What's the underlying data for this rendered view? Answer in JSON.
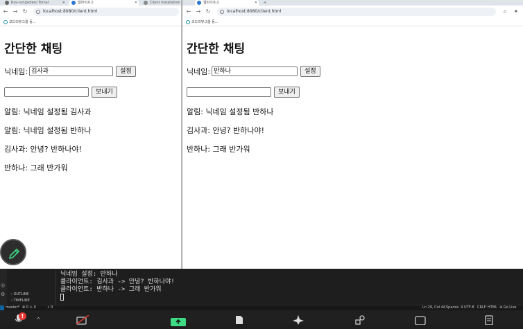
{
  "left_window": {
    "tabs": [
      {
        "label": "Rss-congsolen/ Tornal",
        "active": false
      },
      {
        "label": "웹파이프고",
        "active": true
      },
      {
        "label": "Client installation",
        "active": false
      }
    ],
    "url": "localhost:8080/client.html",
    "bookmark": "코드리뷰그룹 동...",
    "heading": "간단한 채팅",
    "nickname_label": "닉네임:",
    "nickname_value": "김사과",
    "set_button": "설정",
    "message_value": "",
    "send_button": "보내기",
    "messages": [
      "알림: 닉네임 설정됨 김사과",
      "알림: 닉네임 설정됨 반하나",
      "김사과: 안녕? 반하나야!",
      "반하나: 그래 반가워"
    ]
  },
  "right_window": {
    "tabs": [
      {
        "label": "웹파이프고",
        "active": true
      }
    ],
    "url": "localhost:8080/client.html",
    "bookmark": "코드리뷰그룹 동...",
    "heading": "간단한 채팅",
    "nickname_label": "닉네임:",
    "nickname_value": "반하나",
    "set_button": "설정",
    "message_value": "",
    "send_button": "보내기",
    "messages": [
      "알림: 닉네임 설정됨 반하나",
      "김사과: 안녕? 반하나야!",
      "반하나: 그래 반가워"
    ]
  },
  "vscode": {
    "sidebar_sections": [
      "OUTLINE",
      "TIMELINE"
    ],
    "terminal_lines": [
      "닉네임 설정: 반하나",
      "클라이언트: 김사과 -> 안녕? 반하나야!",
      "클라이언트: 반하나 -> 그래 반가워"
    ],
    "status_left": {
      "branch": "master*",
      "problems": "⊗ 0 ⚠ 0",
      "ports": "⚡ 0"
    },
    "status_right": [
      "Ln 29, Col 44",
      "Spaces: 4",
      "UTF-8",
      "CRLF",
      "HTML",
      "⊕ Go Live"
    ]
  },
  "taskbar": {
    "notification_badge": "!"
  },
  "colors": {
    "fab_icon": "#3ddc84",
    "taskbar_accent": "#3ddc84",
    "badge": "#e53935"
  }
}
